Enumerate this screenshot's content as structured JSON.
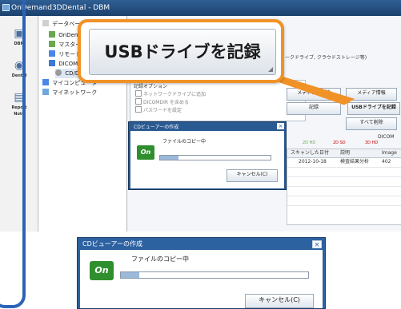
{
  "app": {
    "title": "OnDemand3DDental - DBM",
    "nav": [
      "DBM",
      "Dental",
      "Report",
      "Note"
    ]
  },
  "tree": {
    "header": "データベース",
    "items": [
      "OnDemand",
      "マスター",
      "リモート",
      "DICOM",
      "CD/DVD",
      "マイコンピュータ",
      "マイネットワーク"
    ]
  },
  "main": {
    "hint": "ークドライブ, クラウドストレージ等)",
    "options_title": "記録オプション",
    "checks": [
      "ネットワークドライブに追加",
      "DICOMDIR を含める",
      "パスワードを設定"
    ],
    "media_delete_label": "メディアの削除",
    "media_info_label": "メディア情報",
    "record_label": "記録",
    "usb_record_label": "USBドライブを記録",
    "delete_all_label": "すべて削除",
    "hd_labels": [
      "2D HD",
      "2D SD",
      "3D HD"
    ],
    "right_label": "DICOM",
    "grid_headers": [
      "スキャンした日付",
      "説明",
      "Image"
    ],
    "grid_row": [
      "2012-10-18",
      "検査結果分析",
      "402"
    ]
  },
  "callout": {
    "text": "USBドライブを記録"
  },
  "dialog_small": {
    "title": "CDビューアーの作成",
    "message": "ファイルのコピー中",
    "cancel_label": "キャンセル(C)",
    "close": "×",
    "progress": 0.17
  },
  "dialog_large": {
    "title": "CDビューアーの作成",
    "message": "ファイルのコピー中",
    "cancel_label": "キャンセル(C)",
    "close": "×",
    "progress": 0.1
  },
  "colors": {
    "callout_border": "#f19227",
    "frame": "#2b63b6",
    "dialog_title": "#2d62a1"
  },
  "icons": {
    "dialog_logo": "On"
  }
}
